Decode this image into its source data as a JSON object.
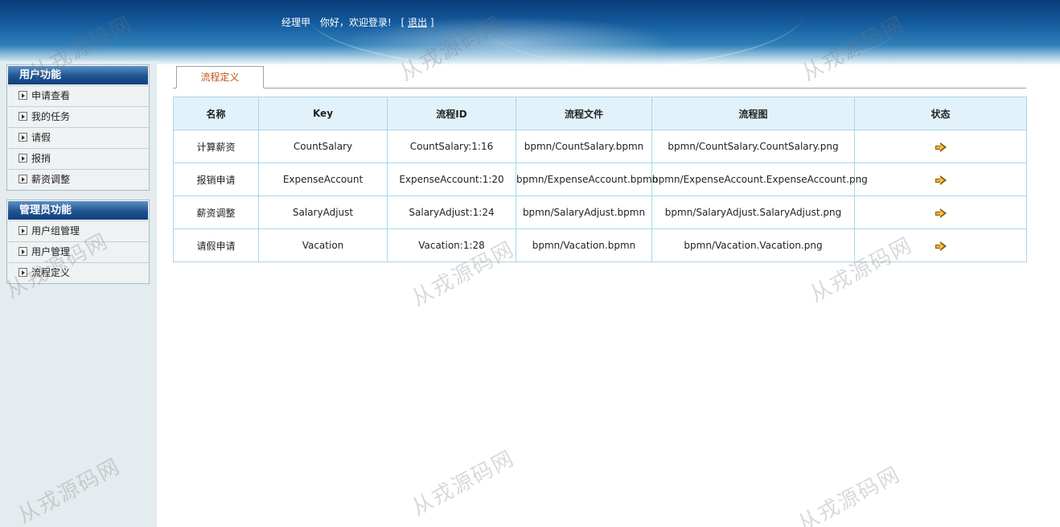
{
  "header": {
    "username": "经理甲",
    "welcome": "你好，欢迎登录!",
    "bracket_open": "[",
    "logout_label": "退出",
    "bracket_close": "]"
  },
  "sidebar": {
    "groups": [
      {
        "title": "用户功能",
        "items": [
          {
            "label": "申请查看"
          },
          {
            "label": "我的任务"
          },
          {
            "label": "请假"
          },
          {
            "label": "报捎"
          },
          {
            "label": "薪资调整"
          }
        ]
      },
      {
        "title": "管理员功能",
        "items": [
          {
            "label": "用户组管理"
          },
          {
            "label": "用户管理"
          },
          {
            "label": "流程定义"
          }
        ]
      }
    ]
  },
  "main": {
    "tab_label": "流程定义",
    "table": {
      "columns": [
        "名称",
        "Key",
        "流程ID",
        "流程文件",
        "流程图",
        "状态"
      ],
      "rows": [
        {
          "name": "计算薪资",
          "key": "CountSalary",
          "id": "CountSalary:1:16",
          "file": "bpmn/CountSalary.bpmn",
          "diagram": "bpmn/CountSalary.CountSalary.png",
          "status_icon": "arrow-right-icon"
        },
        {
          "name": "报销申请",
          "key": "ExpenseAccount",
          "id": "ExpenseAccount:1:20",
          "file": "bpmn/ExpenseAccount.bpmn",
          "diagram": "bpmn/ExpenseAccount.ExpenseAccount.png",
          "status_icon": "arrow-right-icon"
        },
        {
          "name": "薪资调整",
          "key": "SalaryAdjust",
          "id": "SalaryAdjust:1:24",
          "file": "bpmn/SalaryAdjust.bpmn",
          "diagram": "bpmn/SalaryAdjust.SalaryAdjust.png",
          "status_icon": "arrow-right-icon"
        },
        {
          "name": "请假申请",
          "key": "Vacation",
          "id": "Vacation:1:28",
          "file": "bpmn/Vacation.bpmn",
          "diagram": "bpmn/Vacation.Vacation.png",
          "status_icon": "arrow-right-icon"
        }
      ]
    }
  },
  "watermark": {
    "text": "从戎源码网"
  },
  "colors": {
    "header_dark": "#0a3a7a",
    "menu_title": "#1f5592",
    "tab_text": "#c0541a",
    "table_header_bg": "#e2f2fa",
    "table_border": "#a9d6e8",
    "sidebar_bg": "#e4ecef"
  }
}
